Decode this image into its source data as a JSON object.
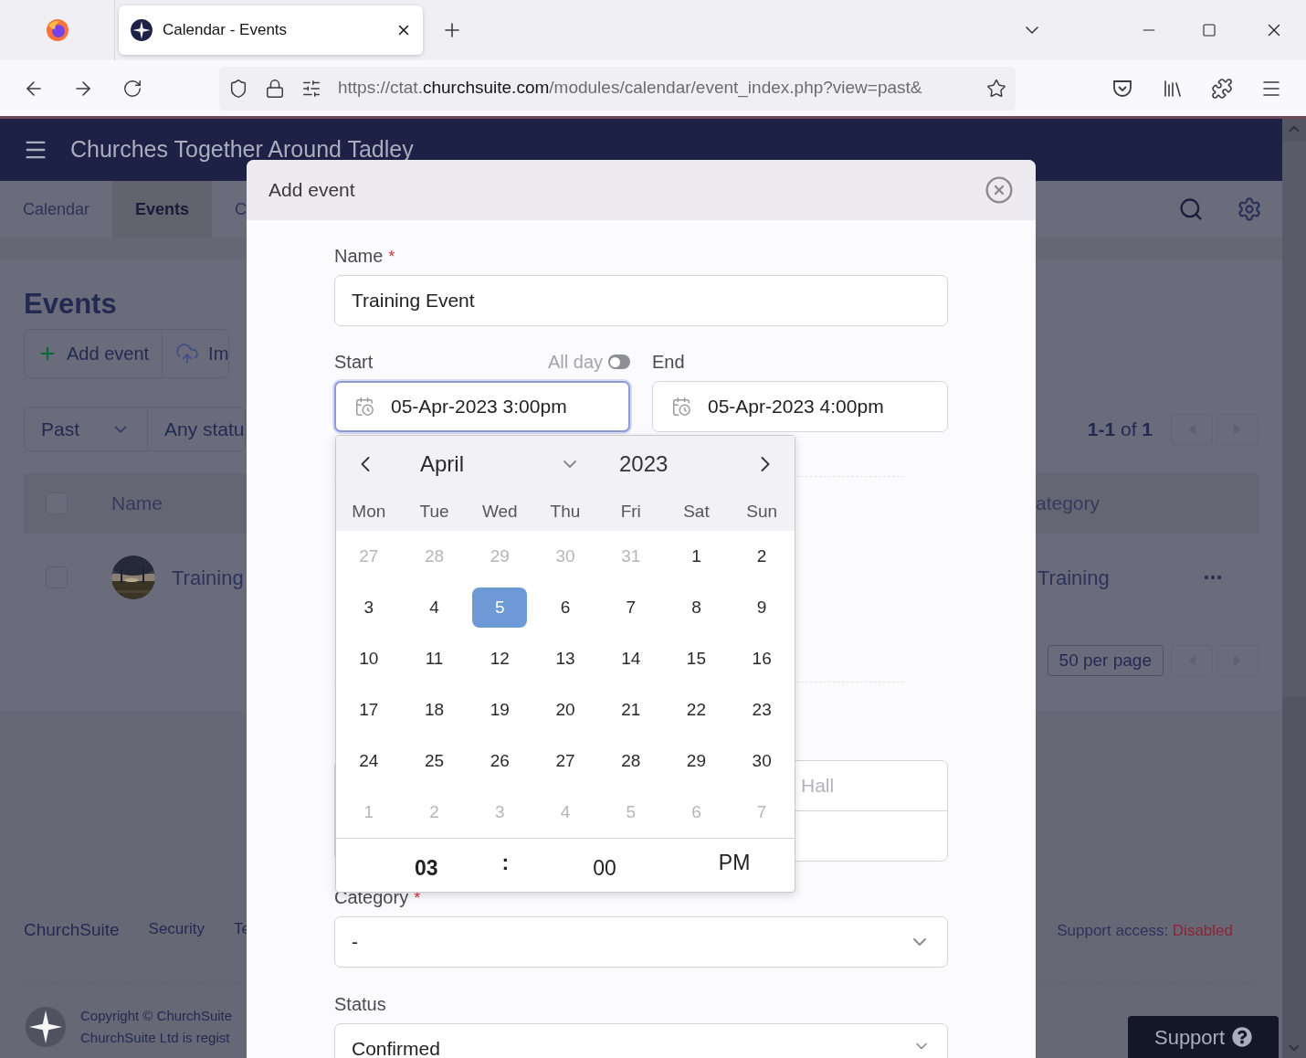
{
  "browser": {
    "tab_title": "Calendar - Events",
    "url": {
      "host_prefix": "https://ctat.",
      "domain": "churchsuite.com",
      "path": "/modules/calendar/event_index.php?view=past&"
    }
  },
  "header": {
    "title": "Churches Together Around Tadley"
  },
  "nav_tabs": [
    {
      "label": "Calendar",
      "selected": false
    },
    {
      "label": "Events",
      "selected": true
    },
    {
      "label": "C",
      "selected": false
    }
  ],
  "page": {
    "heading": "Events",
    "actions": [
      {
        "kind": "add",
        "label": "Add event"
      },
      {
        "kind": "import",
        "label": "Im"
      }
    ],
    "filters": [
      {
        "label": "Past",
        "kind": "dropdown"
      },
      {
        "label": "Any statu",
        "kind": "plain"
      }
    ],
    "pagination": "**1-1** of **1**",
    "table": {
      "header_checked": false,
      "columns": [
        "Name",
        "ategory"
      ],
      "rows": [
        {
          "checked": false,
          "name": "Training",
          "category": "Training"
        }
      ]
    },
    "per_page": "50 per page"
  },
  "footer": {
    "links": [
      "ChurchSuite",
      "Security",
      "Te"
    ],
    "support_access": {
      "label": "Support access:",
      "value": "Disabled"
    },
    "copyright": [
      "Copyright © ChurchSuite",
      "ChurchSuite Ltd is regist"
    ]
  },
  "support_button": "Support",
  "modal": {
    "title": "Add event",
    "name": {
      "label": "Name",
      "required_mark": "*",
      "value": "Training Event"
    },
    "start": {
      "label": "Start",
      "value": "05-Apr-2023 3:00pm",
      "focused": true
    },
    "all_day": {
      "label": "All day",
      "on": false
    },
    "end": {
      "label": "End",
      "value": "05-Apr-2023 4:00pm",
      "focused": false
    },
    "location": {
      "placeholder": "Hall"
    },
    "category": {
      "label": "Category",
      "required_mark": "*",
      "value": "-"
    },
    "status": {
      "label": "Status",
      "value": "Confirmed"
    }
  },
  "datepicker": {
    "month": "April",
    "year": "2023",
    "weekdays": [
      "Mon",
      "Tue",
      "Wed",
      "Thu",
      "Fri",
      "Sat",
      "Sun"
    ],
    "weeks": [
      [
        {
          "day": "27",
          "other_month": true,
          "selected": false
        },
        {
          "day": "28",
          "other_month": true,
          "selected": false
        },
        {
          "day": "29",
          "other_month": true,
          "selected": false
        },
        {
          "day": "30",
          "other_month": true,
          "selected": false
        },
        {
          "day": "31",
          "other_month": true,
          "selected": false
        },
        {
          "day": "1",
          "other_month": false,
          "selected": false
        },
        {
          "day": "2",
          "other_month": false,
          "selected": false
        }
      ],
      [
        {
          "day": "3",
          "other_month": false,
          "selected": false
        },
        {
          "day": "4",
          "other_month": false,
          "selected": false
        },
        {
          "day": "5",
          "other_month": false,
          "selected": true
        },
        {
          "day": "6",
          "other_month": false,
          "selected": false
        },
        {
          "day": "7",
          "other_month": false,
          "selected": false
        },
        {
          "day": "8",
          "other_month": false,
          "selected": false
        },
        {
          "day": "9",
          "other_month": false,
          "selected": false
        }
      ],
      [
        {
          "day": "10",
          "other_month": false,
          "selected": false
        },
        {
          "day": "11",
          "other_month": false,
          "selected": false
        },
        {
          "day": "12",
          "other_month": false,
          "selected": false
        },
        {
          "day": "13",
          "other_month": false,
          "selected": false
        },
        {
          "day": "14",
          "other_month": false,
          "selected": false
        },
        {
          "day": "15",
          "other_month": false,
          "selected": false
        },
        {
          "day": "16",
          "other_month": false,
          "selected": false
        }
      ],
      [
        {
          "day": "17",
          "other_month": false,
          "selected": false
        },
        {
          "day": "18",
          "other_month": false,
          "selected": false
        },
        {
          "day": "19",
          "other_month": false,
          "selected": false
        },
        {
          "day": "20",
          "other_month": false,
          "selected": false
        },
        {
          "day": "21",
          "other_month": false,
          "selected": false
        },
        {
          "day": "22",
          "other_month": false,
          "selected": false
        },
        {
          "day": "23",
          "other_month": false,
          "selected": false
        }
      ],
      [
        {
          "day": "24",
          "other_month": false,
          "selected": false
        },
        {
          "day": "25",
          "other_month": false,
          "selected": false
        },
        {
          "day": "26",
          "other_month": false,
          "selected": false
        },
        {
          "day": "27",
          "other_month": false,
          "selected": false
        },
        {
          "day": "28",
          "other_month": false,
          "selected": false
        },
        {
          "day": "29",
          "other_month": false,
          "selected": false
        },
        {
          "day": "30",
          "other_month": false,
          "selected": false
        }
      ],
      [
        {
          "day": "1",
          "other_month": true,
          "selected": false
        },
        {
          "day": "2",
          "other_month": true,
          "selected": false
        },
        {
          "day": "3",
          "other_month": true,
          "selected": false
        },
        {
          "day": "4",
          "other_month": true,
          "selected": false
        },
        {
          "day": "5",
          "other_month": true,
          "selected": false
        },
        {
          "day": "6",
          "other_month": true,
          "selected": false
        },
        {
          "day": "7",
          "other_month": true,
          "selected": false
        }
      ]
    ],
    "time": {
      "hour": "03",
      "separator": ":",
      "minute": "00",
      "period": "PM"
    }
  }
}
